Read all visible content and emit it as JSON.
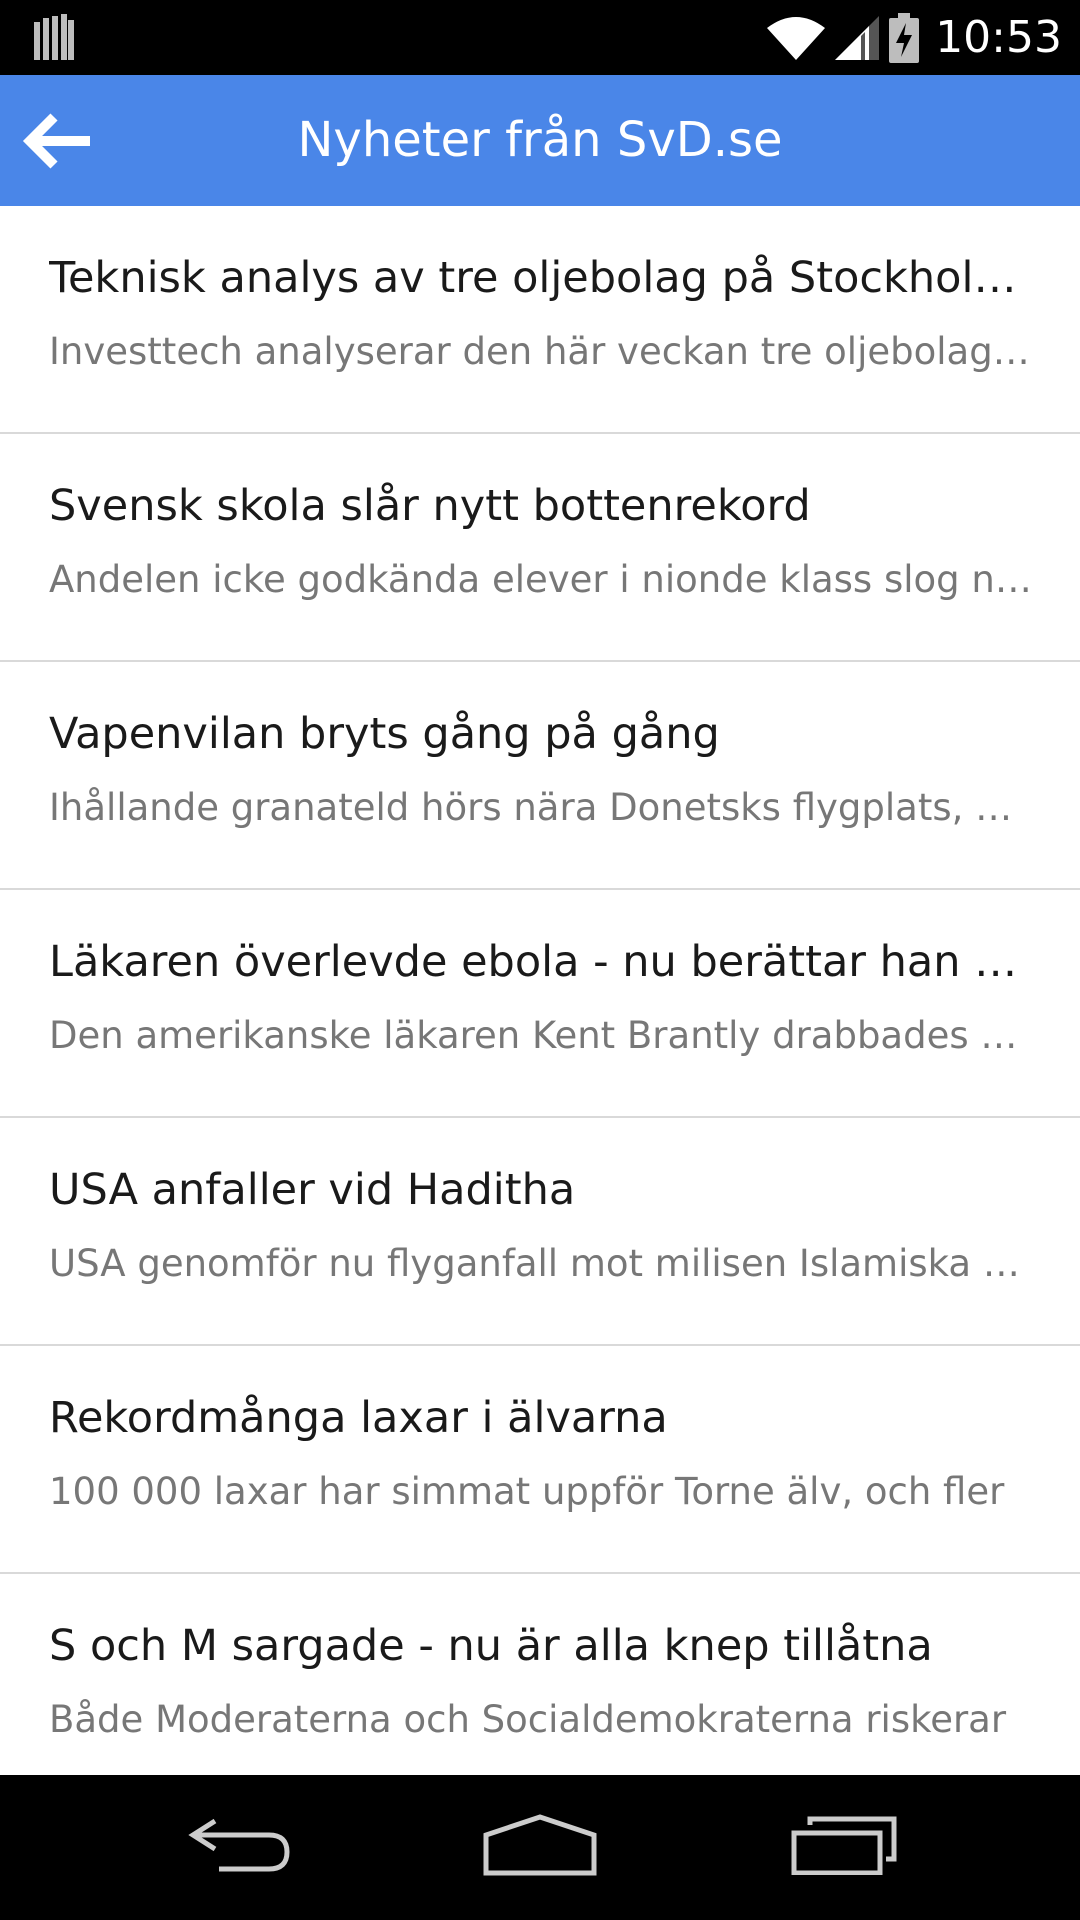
{
  "status_bar": {
    "time": "10:53",
    "icons": [
      "notification-bars-icon",
      "wifi-icon",
      "cellular-signal-icon",
      "battery-charging-icon"
    ]
  },
  "app_bar": {
    "title": "Nyheter från SvD.se",
    "back_icon": "arrow-left-icon",
    "color": "#4a86e8"
  },
  "articles": [
    {
      "title": "Teknisk analys av tre oljebolag på Stockholmsbörsen",
      "summary": "Investtech analyserar den här veckan tre oljebolag på Stockholmsbörsen"
    },
    {
      "title": "Svensk skola slår nytt bottenrekord",
      "summary": "Andelen icke godkända elever i nionde klass slog nytt rekord"
    },
    {
      "title": "Vapenvilan bryts gång på gång",
      "summary": "Ihållande granateld hörs nära Donetsks flygplats, uppger"
    },
    {
      "title": "Läkaren överlevde ebola - nu berättar han med",
      "summary": "Den amerikanske läkaren Kent Brantly drabbades av ebola"
    },
    {
      "title": "USA anfaller vid Haditha",
      "summary": "USA genomför nu flyganfall mot milisen Islamiska staten"
    },
    {
      "title": "Rekordmånga laxar i älvarna",
      "summary": "100 000 laxar har simmat uppför Torne älv, och fler"
    },
    {
      "title": "S och M sargade - nu är alla knep tillåtna",
      "summary": "Både Moderaterna och Socialdemokraterna riskerar"
    }
  ],
  "nav_bar": {
    "buttons": [
      "back-nav-icon",
      "home-nav-icon",
      "recent-apps-icon"
    ]
  }
}
